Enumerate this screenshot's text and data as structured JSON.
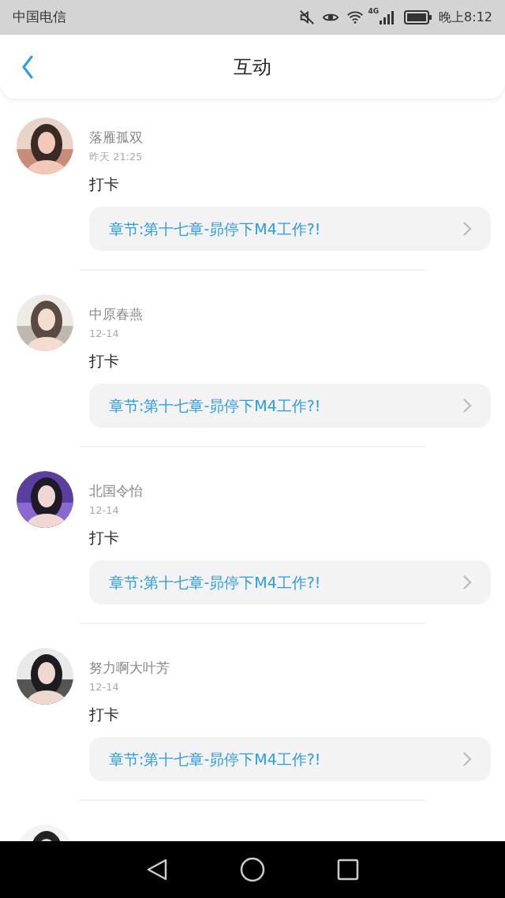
{
  "status_bar": {
    "carrier": "中国电信",
    "network": "4G",
    "time": "晚上8:12"
  },
  "header": {
    "title": "互动"
  },
  "items": [
    {
      "kind": "full",
      "name": "落雁孤双",
      "time": "昨天 21:25",
      "content": "打卡",
      "link": "章节:第十七章-昴停下M4工作?!"
    },
    {
      "kind": "full",
      "name": "中原春燕",
      "time": "12-14",
      "content": "打卡",
      "link": "章节:第十七章-昴停下M4工作?!"
    },
    {
      "kind": "full",
      "name": "北国令怡",
      "time": "12-14",
      "content": "打卡",
      "link": "章节:第十七章-昴停下M4工作?!"
    },
    {
      "kind": "full",
      "name": "努力啊大叶芳",
      "time": "12-14",
      "content": "打卡",
      "link": "章节:第十七章-昴停下M4工作?!"
    },
    {
      "kind": "partial"
    }
  ]
}
